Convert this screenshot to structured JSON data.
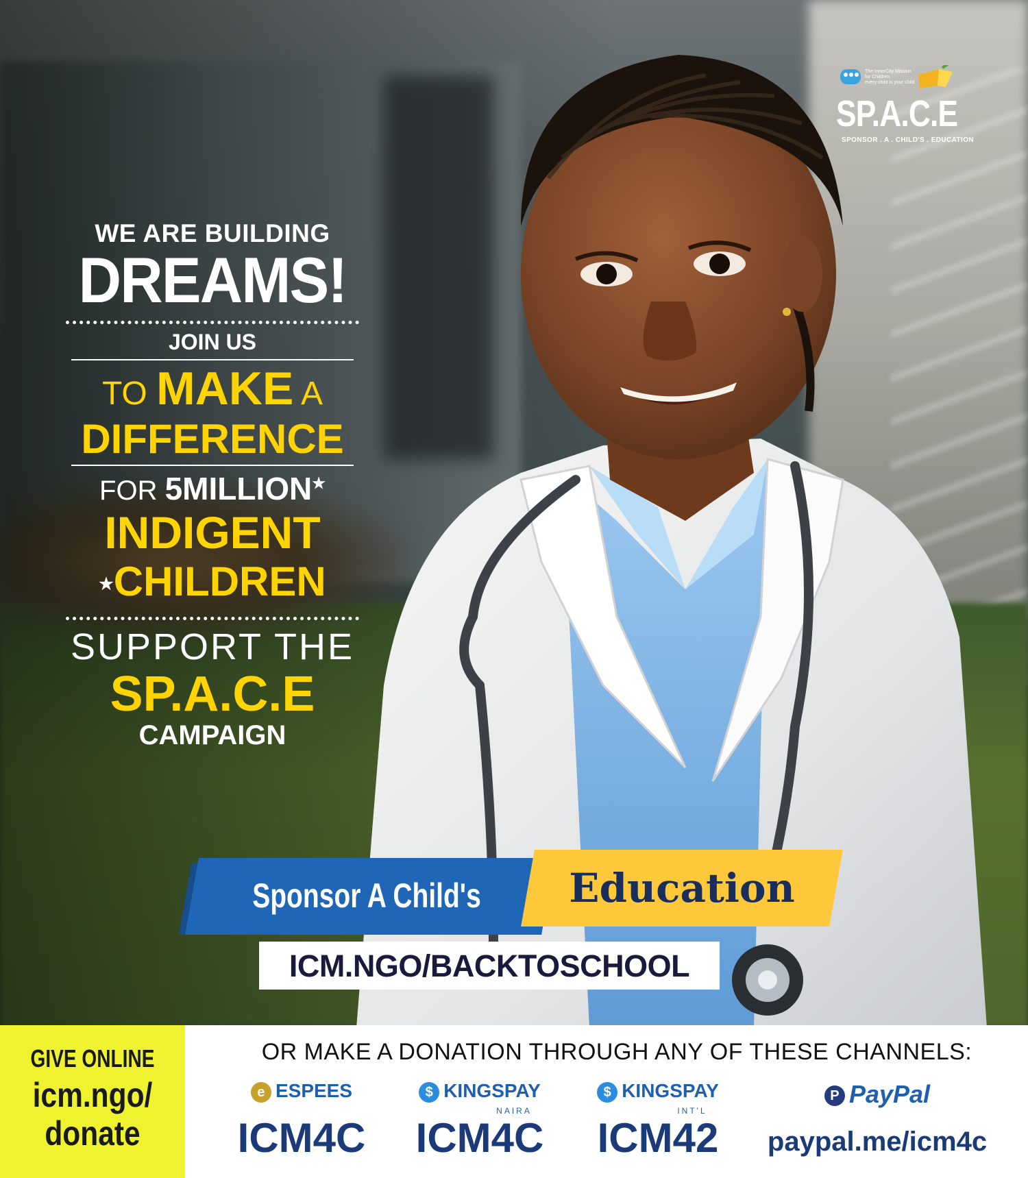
{
  "logo": {
    "org_line1": "The InnerCity Mission",
    "org_line2": "for Children",
    "org_line3": "every child is your child",
    "title": "SP.A.C.E",
    "subtitle": "SPONSOR . A . CHILD'S . EDUCATION"
  },
  "headline": {
    "line1": "WE ARE BUILDING",
    "line2": "DREAMS!",
    "line3": "JOIN US",
    "line4_pre": "TO ",
    "line4_main": "MAKE",
    "line4_post": " A",
    "line5": "DIFFERENCE",
    "line6_pre": "FOR ",
    "line6_main": "5MILLION",
    "line7": "INDIGENT",
    "line8": "CHILDREN",
    "line9": "SUPPORT THE",
    "line10": "SP.A.C.E",
    "line11": "CAMPAIGN"
  },
  "banner": {
    "left": "Sponsor A Child's",
    "right": "Education",
    "url": "ICM.NGO/BACKTOSCHOOL"
  },
  "give_online": {
    "label": "GIVE ONLINE",
    "url_line1": "icm.ngo/",
    "url_line2": "donate"
  },
  "channels": {
    "title": "OR MAKE A DONATION THROUGH ANY OF THESE CHANNELS:",
    "items": [
      {
        "brand": "ESPEES",
        "sub": "",
        "code": "ICM4C"
      },
      {
        "brand": "KINGSPAY",
        "sub": "NAIRA",
        "code": "ICM4C"
      },
      {
        "brand": "KINGSPAY",
        "sub": "INT'L",
        "code": "ICM42"
      },
      {
        "brand": "PayPal",
        "sub": "",
        "code": "paypal.me/icm4c"
      }
    ]
  },
  "colors": {
    "accent_yellow": "#ffd400",
    "banner_blue": "#1f66b6",
    "banner_yellow": "#ffc83a",
    "code_blue": "#1b3a78"
  }
}
